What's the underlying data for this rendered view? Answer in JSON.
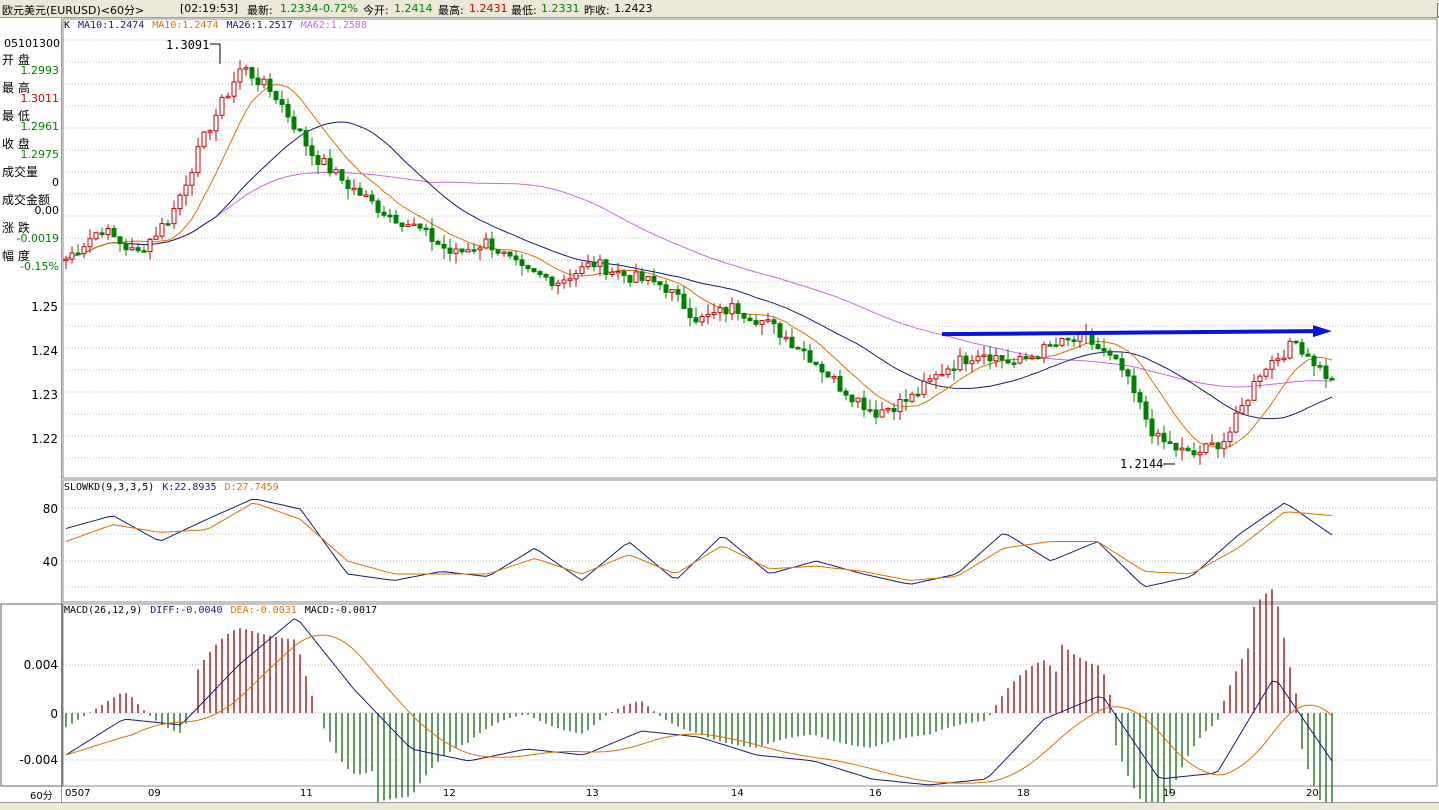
{
  "header": {
    "title": "欧元美元(EURUSD)<60分>",
    "time": "[02:19:53]",
    "latest_label": "最新:",
    "latest": "1.2334",
    "change_pct": "-0.72%",
    "open_label": "今开:",
    "open": "1.2414",
    "high_label": "最高:",
    "high": "1.2431",
    "low_label": "最低:",
    "low": "1.2331",
    "prev_label": "昨收:",
    "prev": "1.2423"
  },
  "window_buttons": [
    "⇦",
    "⇨",
    "⇧"
  ],
  "sidebar": {
    "date": "05101300",
    "items": [
      {
        "label": "开 盘",
        "value": "1.2993",
        "color": "#008000"
      },
      {
        "label": "最 高",
        "value": "1.3011",
        "color": "#cc0000"
      },
      {
        "label": "最 低",
        "value": "1.2961",
        "color": "#008000"
      },
      {
        "label": "收 盘",
        "value": "1.2975",
        "color": "#008000"
      },
      {
        "label": "成交量",
        "value": "0",
        "color": "#000000"
      },
      {
        "label": "成交金额",
        "value": "0.00",
        "color": "#000000"
      },
      {
        "label": "涨 跌",
        "value": "-0.0019",
        "color": "#008000"
      },
      {
        "label": "幅 度",
        "value": "-0.15%",
        "color": "#008000"
      }
    ],
    "footer": "60分"
  },
  "main_panel": {
    "legend": {
      "k": "K",
      "ma10a": "MA10:1.2474",
      "ma10b": "MA10:1.2474",
      "ma26": "MA26:1.2517",
      "ma62": "MA62:1.2588"
    },
    "y_ticks": [
      "1.25",
      "1.24",
      "1.23",
      "1.22"
    ],
    "high_annotation": "1.3091",
    "low_annotation": "1.2144"
  },
  "kd_panel": {
    "legend": {
      "name": "SLOWKD(9,3,3,5)",
      "k": "K:22.8935",
      "d": "D:27.7459"
    },
    "y_ticks": [
      "80",
      "40"
    ]
  },
  "macd_panel": {
    "legend": {
      "name": "MACD(26,12,9)",
      "diff": "DIFF:-0.0040",
      "dea": "DEA:-0.0031",
      "macd": "MACD:-0.0017"
    },
    "y_ticks": [
      "0.004",
      "0",
      "-0.004"
    ]
  },
  "x_axis": [
    "0507",
    "09",
    "11",
    "12",
    "13",
    "14",
    "16",
    "18",
    "19",
    "20"
  ],
  "colors": {
    "up": "#cc0000",
    "down": "#008000",
    "ma10": "#e07000",
    "ma26": "#1a1a70",
    "ma62": "#cc66ee",
    "arrow": "#0a14d8",
    "grid": "#b8b8b8"
  },
  "chart_data": {
    "type": "candlestick",
    "x_labels": [
      "0507",
      "09",
      "11",
      "12",
      "13",
      "14",
      "16",
      "18",
      "19",
      "20"
    ],
    "price_axis": {
      "ticks": [
        1.25,
        1.24,
        1.23,
        1.22
      ]
    },
    "price_path": [
      1.261,
      1.268,
      1.262,
      1.271,
      1.29,
      1.305,
      1.298,
      1.285,
      1.278,
      1.272,
      1.268,
      1.262,
      1.265,
      1.258,
      1.256,
      1.26,
      1.257,
      1.255,
      1.247,
      1.25,
      1.246,
      1.24,
      1.232,
      1.226,
      1.229,
      1.236,
      1.24,
      1.237,
      1.241,
      1.243,
      1.236,
      1.22,
      1.216,
      1.22,
      1.236,
      1.242,
      1.233
    ],
    "annotations": [
      {
        "text": "1.3091",
        "value": 1.3091
      },
      {
        "text": "1.2144",
        "value": 1.2144
      }
    ],
    "arrow": {
      "from_value": 1.2443,
      "to_value": 1.2443
    },
    "kd": {
      "k_path": [
        65,
        75,
        55,
        72,
        88,
        80,
        30,
        25,
        32,
        28,
        50,
        25,
        55,
        25,
        60,
        30,
        40,
        30,
        22,
        30,
        62,
        40,
        55,
        20,
        28,
        60,
        85,
        60
      ],
      "d_path": [
        55,
        68,
        62,
        64,
        85,
        72,
        40,
        30,
        30,
        30,
        42,
        30,
        45,
        30,
        52,
        34,
        36,
        32,
        25,
        28,
        50,
        55,
        55,
        32,
        30,
        50,
        78,
        75
      ]
    },
    "macd": {
      "diff_path": [
        -0.0035,
        -0.0005,
        -0.001,
        0.004,
        0.008,
        0.002,
        -0.003,
        -0.004,
        -0.003,
        -0.0035,
        -0.0015,
        -0.002,
        -0.0035,
        -0.004,
        -0.0055,
        -0.006,
        -0.0055,
        -0.0005,
        0.0015,
        -0.0055,
        -0.005,
        0.003,
        -0.004
      ]
    }
  }
}
